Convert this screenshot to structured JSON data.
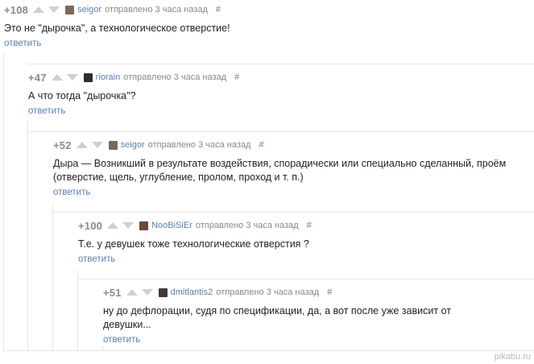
{
  "comments": [
    {
      "rating": "+108",
      "username": "seigor",
      "meta": "отправлено 3 часа назад",
      "hash": "#",
      "text": "Это не \"дырочка\", а технологическое отверстие!",
      "reply": "ответить",
      "avatar_color": "#7a6a55"
    },
    {
      "rating": "+47",
      "username": "riorain",
      "meta": "отправлено 3 часа назад",
      "hash": "#",
      "text": "А что тогда \"дырочка\"?",
      "reply": "ответить",
      "avatar_color": "#2e2e2e"
    },
    {
      "rating": "+52",
      "username": "seigor",
      "meta": "отправлено 3 часа назад",
      "hash": "#",
      "text": "Дыра — Возникший в результате воздействия, спорадически или специально сделанный, проём (отверстие, щель, углубление, пролом, проход и т. п.)",
      "reply": "ответить",
      "avatar_color": "#7a6a55"
    },
    {
      "rating": "+100",
      "username": "NooBiSiEr",
      "meta": "отправлено 3 часа назад",
      "hash": "#",
      "text": "Т.е. у девушек тоже технологические отверстия ?",
      "reply": "ответить",
      "avatar_color": "#6b4a35"
    },
    {
      "rating": "+51",
      "username": "dmitlantis2",
      "meta": "отправлено 3 часа назад",
      "hash": "#",
      "text": "ну до дефлорации, судя по спецификации, да, а вот после уже зависит от девушки...",
      "reply": "ответить",
      "avatar_color": "#3c3c3c"
    }
  ],
  "watermark": "pikabu.ru"
}
